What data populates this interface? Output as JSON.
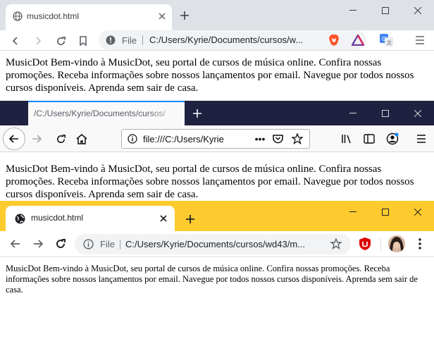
{
  "windows": [
    {
      "tab_title": "musicdot.html",
      "omnibox_label": "File",
      "url": "C:/Users/Kyrie/Documents/cursos/w...",
      "content": "MusicDot Bem-vindo à MusicDot, seu portal de cursos de música online. Confira nossas promoções. Receba informações sobre nossos lançamentos por email. Navegue por todos nossos cursos disponíveis. Aprenda sem sair de casa."
    },
    {
      "tab_title": "/C:/Users/Kyrie/Documents/cursos/",
      "url": "file:///C:/Users/Kyrie",
      "content": "MusicDot Bem-vindo à MusicDot, seu portal de cursos de música online. Confira nossas promoções. Receba informações sobre nossos lançamentos por email. Navegue por todos nossos cursos disponíveis. Aprenda sem sair de casa."
    },
    {
      "tab_title": "musicdot.html",
      "omnibox_label": "File",
      "url": "C:/Users/Kyrie/Documents/cursos/wd43/m...",
      "content": "MusicDot Bem-vindo à MusicDot, seu portal de cursos de música online. Confira nossas promoções. Receba informações sobre nossos lançamentos por email. Navegue por todos nossos cursos disponíveis. Aprenda sem sair de casa."
    }
  ],
  "icons": {
    "globe": "globe-icon",
    "close": "close-icon",
    "plus": "new-tab-icon",
    "back": "back-arrow-icon",
    "forward": "forward-arrow-icon",
    "reload": "reload-icon",
    "home": "home-icon",
    "bookmark": "bookmark-icon",
    "info": "info-icon",
    "star": "star-icon",
    "menu": "menu-icon"
  },
  "colors": {
    "chrome_grey_tabbar": "#dee1e6",
    "firefox_tabbar": "#1f2140",
    "firefox_accent": "#0a84ff",
    "chrome_yellow_tabbar": "#fdcb2d",
    "brave_orange": "#fb542b",
    "ublock_red": "#e00000"
  }
}
